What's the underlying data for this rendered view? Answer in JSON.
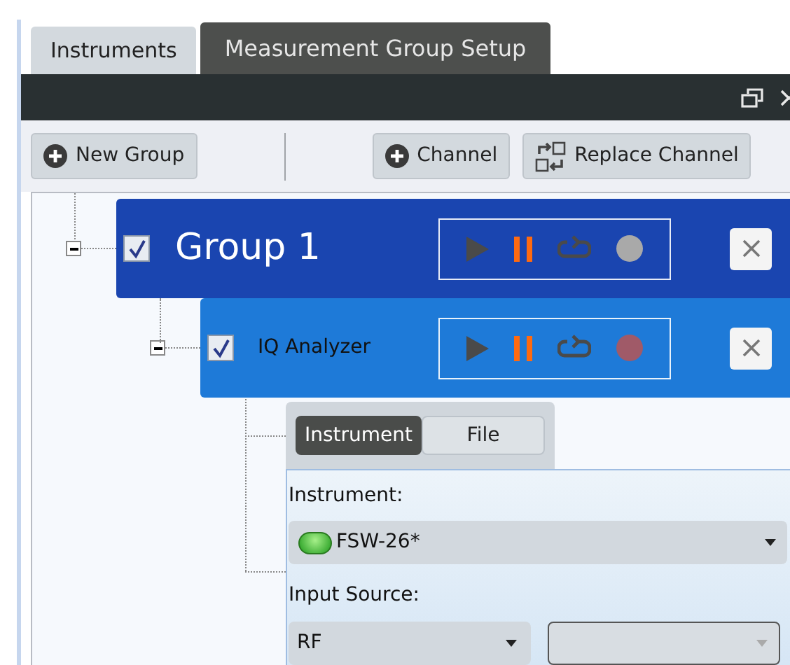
{
  "tabs": [
    {
      "label": "Instruments",
      "selected": false
    },
    {
      "label": "Measurement Group Setup",
      "selected": true
    }
  ],
  "toolbar": {
    "buttons": [
      {
        "label": "New Group",
        "kind": "add"
      },
      {
        "label": "Channel",
        "kind": "add"
      },
      {
        "label": "Replace Channel",
        "kind": "replace"
      }
    ]
  },
  "tree": [
    {
      "kind": "group",
      "label": "Group 1",
      "checked": true,
      "expanded": true,
      "color": "#a9a9a9",
      "children": [
        {
          "kind": "channel",
          "label": "IQ Analyzer",
          "checked": true,
          "expanded": true,
          "color": "#a05a68"
        }
      ]
    }
  ],
  "source_tabs": [
    {
      "label": "Instrument",
      "selected": true
    },
    {
      "label": "File",
      "selected": false
    }
  ],
  "form": {
    "instrument_label": "Instrument:",
    "instrument": {
      "value": "FSW-26*",
      "connected": true
    },
    "input_source_label": "Input Source:",
    "input_source": {
      "value": "RF"
    },
    "input_source_2": {
      "disabled": true
    }
  }
}
